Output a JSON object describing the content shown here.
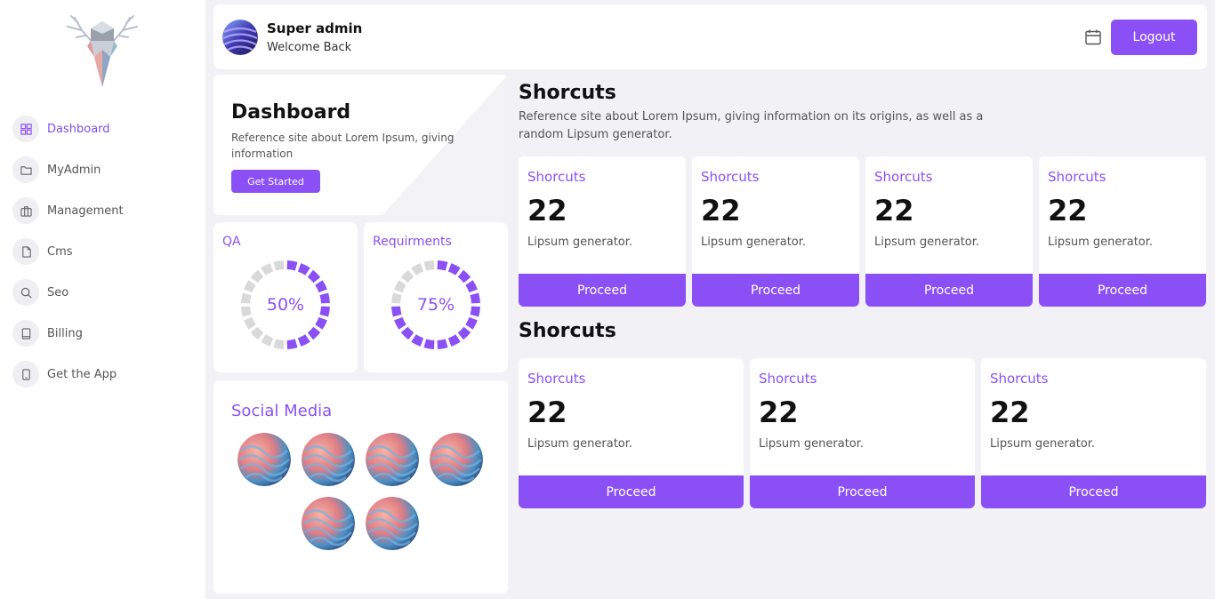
{
  "sidebar": {
    "items": [
      {
        "label": "Dashboard",
        "icon": "grid-icon",
        "active": true
      },
      {
        "label": "MyAdmin",
        "icon": "folder-icon"
      },
      {
        "label": "Management",
        "icon": "briefcase-icon"
      },
      {
        "label": "Cms",
        "icon": "file-icon"
      },
      {
        "label": "Seo",
        "icon": "search-icon"
      },
      {
        "label": "Billing",
        "icon": "book-icon"
      },
      {
        "label": "Get the App",
        "icon": "tablet-icon"
      }
    ]
  },
  "header": {
    "user_name": "Super admin",
    "user_sub": "Welcome Back",
    "logout_label": "Logout"
  },
  "dashboard": {
    "title": "Dashboard",
    "description": "Reference site about Lorem Ipsum, giving information",
    "button_label": "Get Started"
  },
  "progress": [
    {
      "title": "QA",
      "value": 50,
      "label": "50%"
    },
    {
      "title": "Requirments",
      "value": 75,
      "label": "75%"
    }
  ],
  "social": {
    "title": "Social Media"
  },
  "shortcuts_top": {
    "title": "Shorcuts",
    "description": "Reference site about Lorem Ipsum, giving information on its origins, as well as a random Lipsum generator.",
    "cards": [
      {
        "label": "Shorcuts",
        "value": "22",
        "sub": "Lipsum generator.",
        "button": "Proceed"
      },
      {
        "label": "Shorcuts",
        "value": "22",
        "sub": "Lipsum generator.",
        "button": "Proceed"
      },
      {
        "label": "Shorcuts",
        "value": "22",
        "sub": "Lipsum generator.",
        "button": "Proceed"
      },
      {
        "label": "Shorcuts",
        "value": "22",
        "sub": "Lipsum generator.",
        "button": "Proceed"
      }
    ]
  },
  "shortcuts_bottom": {
    "title": "Shorcuts",
    "cards": [
      {
        "label": "Shorcuts",
        "value": "22",
        "sub": "Lipsum generator.",
        "button": "Proceed"
      },
      {
        "label": "Shorcuts",
        "value": "22",
        "sub": "Lipsum generator.",
        "button": "Proceed"
      },
      {
        "label": "Shorcuts",
        "value": "22",
        "sub": "Lipsum generator.",
        "button": "Proceed"
      }
    ]
  },
  "colors": {
    "accent": "#8b50f5",
    "track": "#d9d9d9"
  }
}
